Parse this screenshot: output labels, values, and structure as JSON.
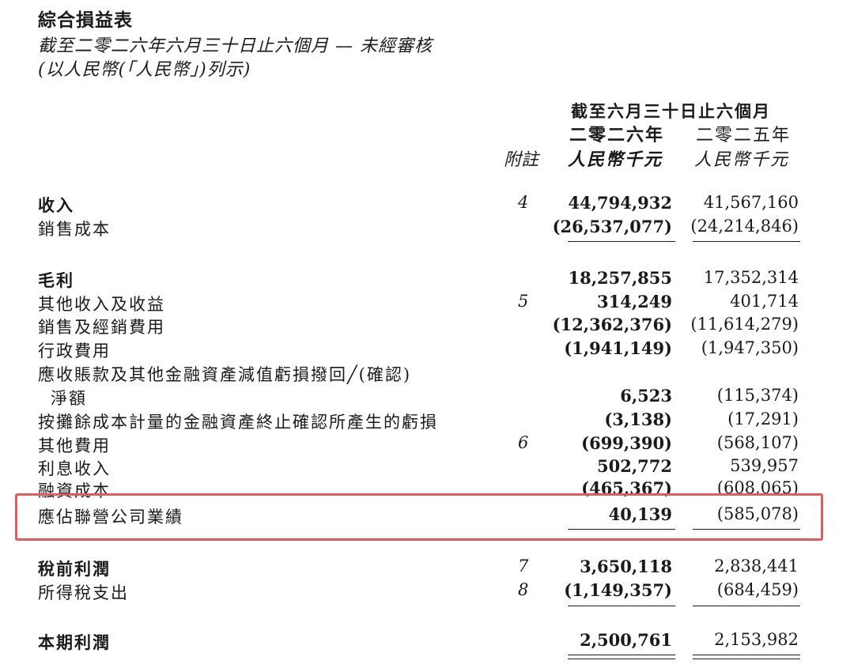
{
  "header": {
    "title": "綜合損益表",
    "subtitle": "截至二零二六年六月三十日止六個月 — 未經審核",
    "currency_note": "(以人民幣(「人民幣」)列示)"
  },
  "columns": {
    "period": "截至六月三十日止六個月",
    "note_label": "附註",
    "year_current": "二零二六年",
    "year_previous": "二零二五年",
    "unit_current": "人民幣千元",
    "unit_previous": "人民幣千元"
  },
  "rows": [
    {
      "label": "收入",
      "note": "4",
      "current": "44,794,932",
      "previous": "41,567,160"
    },
    {
      "label": "銷售成本",
      "note": "",
      "current": "(26,537,077)",
      "previous": "(24,214,846)"
    },
    {
      "label": "毛利",
      "note": "",
      "current": "18,257,855",
      "previous": "17,352,314"
    },
    {
      "label": "其他收入及收益",
      "note": "5",
      "current": "314,249",
      "previous": "401,714"
    },
    {
      "label": "銷售及經銷費用",
      "note": "",
      "current": "(12,362,376)",
      "previous": "(11,614,279)"
    },
    {
      "label": "行政費用",
      "note": "",
      "current": "(1,941,149)",
      "previous": "(1,947,350)"
    },
    {
      "label": "應收賬款及其他金融資產減值虧損撥回╱(確認)",
      "label_cont": "淨額",
      "note": "",
      "current": "6,523",
      "previous": "(115,374)"
    },
    {
      "label": "按攤餘成本計量的金融資產終止確認所產生的虧損",
      "note": "",
      "current": "(3,138)",
      "previous": "(17,291)"
    },
    {
      "label": "其他費用",
      "note": "6",
      "current": "(699,390)",
      "previous": "(568,107)"
    },
    {
      "label": "利息收入",
      "note": "",
      "current": "502,772",
      "previous": "539,957"
    },
    {
      "label": "融資成本",
      "note": "",
      "current": "(465,367)",
      "previous": "(608,065)"
    },
    {
      "label": "應佔聯營公司業績",
      "note": "",
      "current": "40,139",
      "previous": "(585,078)"
    },
    {
      "label": "稅前利潤",
      "note": "7",
      "current": "3,650,118",
      "previous": "2,838,441"
    },
    {
      "label": "所得稅支出",
      "note": "8",
      "current": "(1,149,357)",
      "previous": "(684,459)"
    },
    {
      "label": "本期利潤",
      "note": "",
      "current": "2,500,761",
      "previous": "2,153,982"
    }
  ],
  "highlight_color": "#e05a60"
}
